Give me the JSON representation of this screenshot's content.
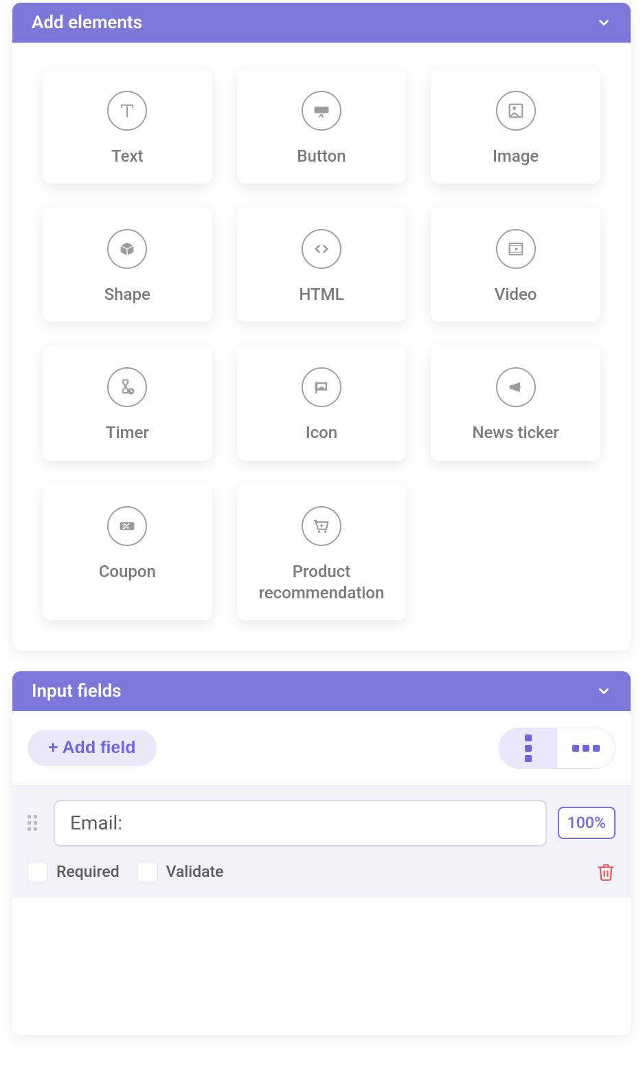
{
  "panels": {
    "add_elements": {
      "title": "Add elements"
    },
    "input_fields": {
      "title": "Input fields",
      "add_field_label": "+ Add field",
      "fields": [
        {
          "value": "Email:",
          "width_pct": "100%",
          "required_label": "Required",
          "validate_label": "Validate",
          "required": false,
          "validate": false
        }
      ]
    }
  },
  "elements": [
    {
      "label": "Text",
      "icon": "text-icon"
    },
    {
      "label": "Button",
      "icon": "button-icon"
    },
    {
      "label": "Image",
      "icon": "image-icon"
    },
    {
      "label": "Shape",
      "icon": "shape-icon"
    },
    {
      "label": "HTML",
      "icon": "html-icon"
    },
    {
      "label": "Video",
      "icon": "video-icon"
    },
    {
      "label": "Timer",
      "icon": "timer-icon"
    },
    {
      "label": "Icon",
      "icon": "icon-icon"
    },
    {
      "label": "News ticker",
      "icon": "news-icon"
    },
    {
      "label": "Coupon",
      "icon": "coupon-icon"
    },
    {
      "label": "Product recommendation",
      "icon": "product-icon"
    }
  ],
  "colors": {
    "accent": "#7c78d9",
    "accent_light": "#ebe7fa",
    "danger": "#e76464"
  }
}
